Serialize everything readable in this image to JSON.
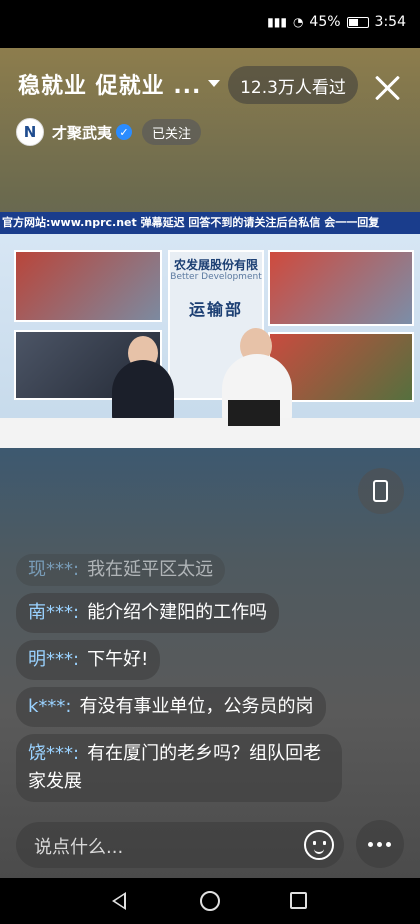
{
  "status_bar": {
    "battery": "45%",
    "time": "3:54"
  },
  "header": {
    "title": "稳就业 促就业 ...",
    "viewers": "12.3万人看过",
    "host_name": "才聚武夷",
    "follow_label": "已关注"
  },
  "video": {
    "marquee": "官方网站:www.nprc.net 弹幕延迟 回答不到的请关注后台私信 会一一回复",
    "panel_title": "农发展股份有限",
    "panel_sub": "Better Development",
    "panel_dept": "运输部"
  },
  "comments": [
    {
      "user": "现***:",
      "msg": "我在延平区太远"
    },
    {
      "user": "南***:",
      "msg": "能介绍个建阳的工作吗"
    },
    {
      "user": "明***:",
      "msg": "下午好!"
    },
    {
      "user": "k***:",
      "msg": "有没有事业单位，公务员的岗"
    },
    {
      "user": "饶***:",
      "msg": "有在厦门的老乡吗？组队回老家发展"
    }
  ],
  "input": {
    "placeholder": "说点什么..."
  },
  "icons": [
    "signal-icon",
    "wifi-icon",
    "battery-icon",
    "close-icon",
    "verified-icon",
    "phone-icon",
    "emoji-icon",
    "more-icon",
    "nav-back-icon",
    "nav-home-icon",
    "nav-recent-icon"
  ]
}
